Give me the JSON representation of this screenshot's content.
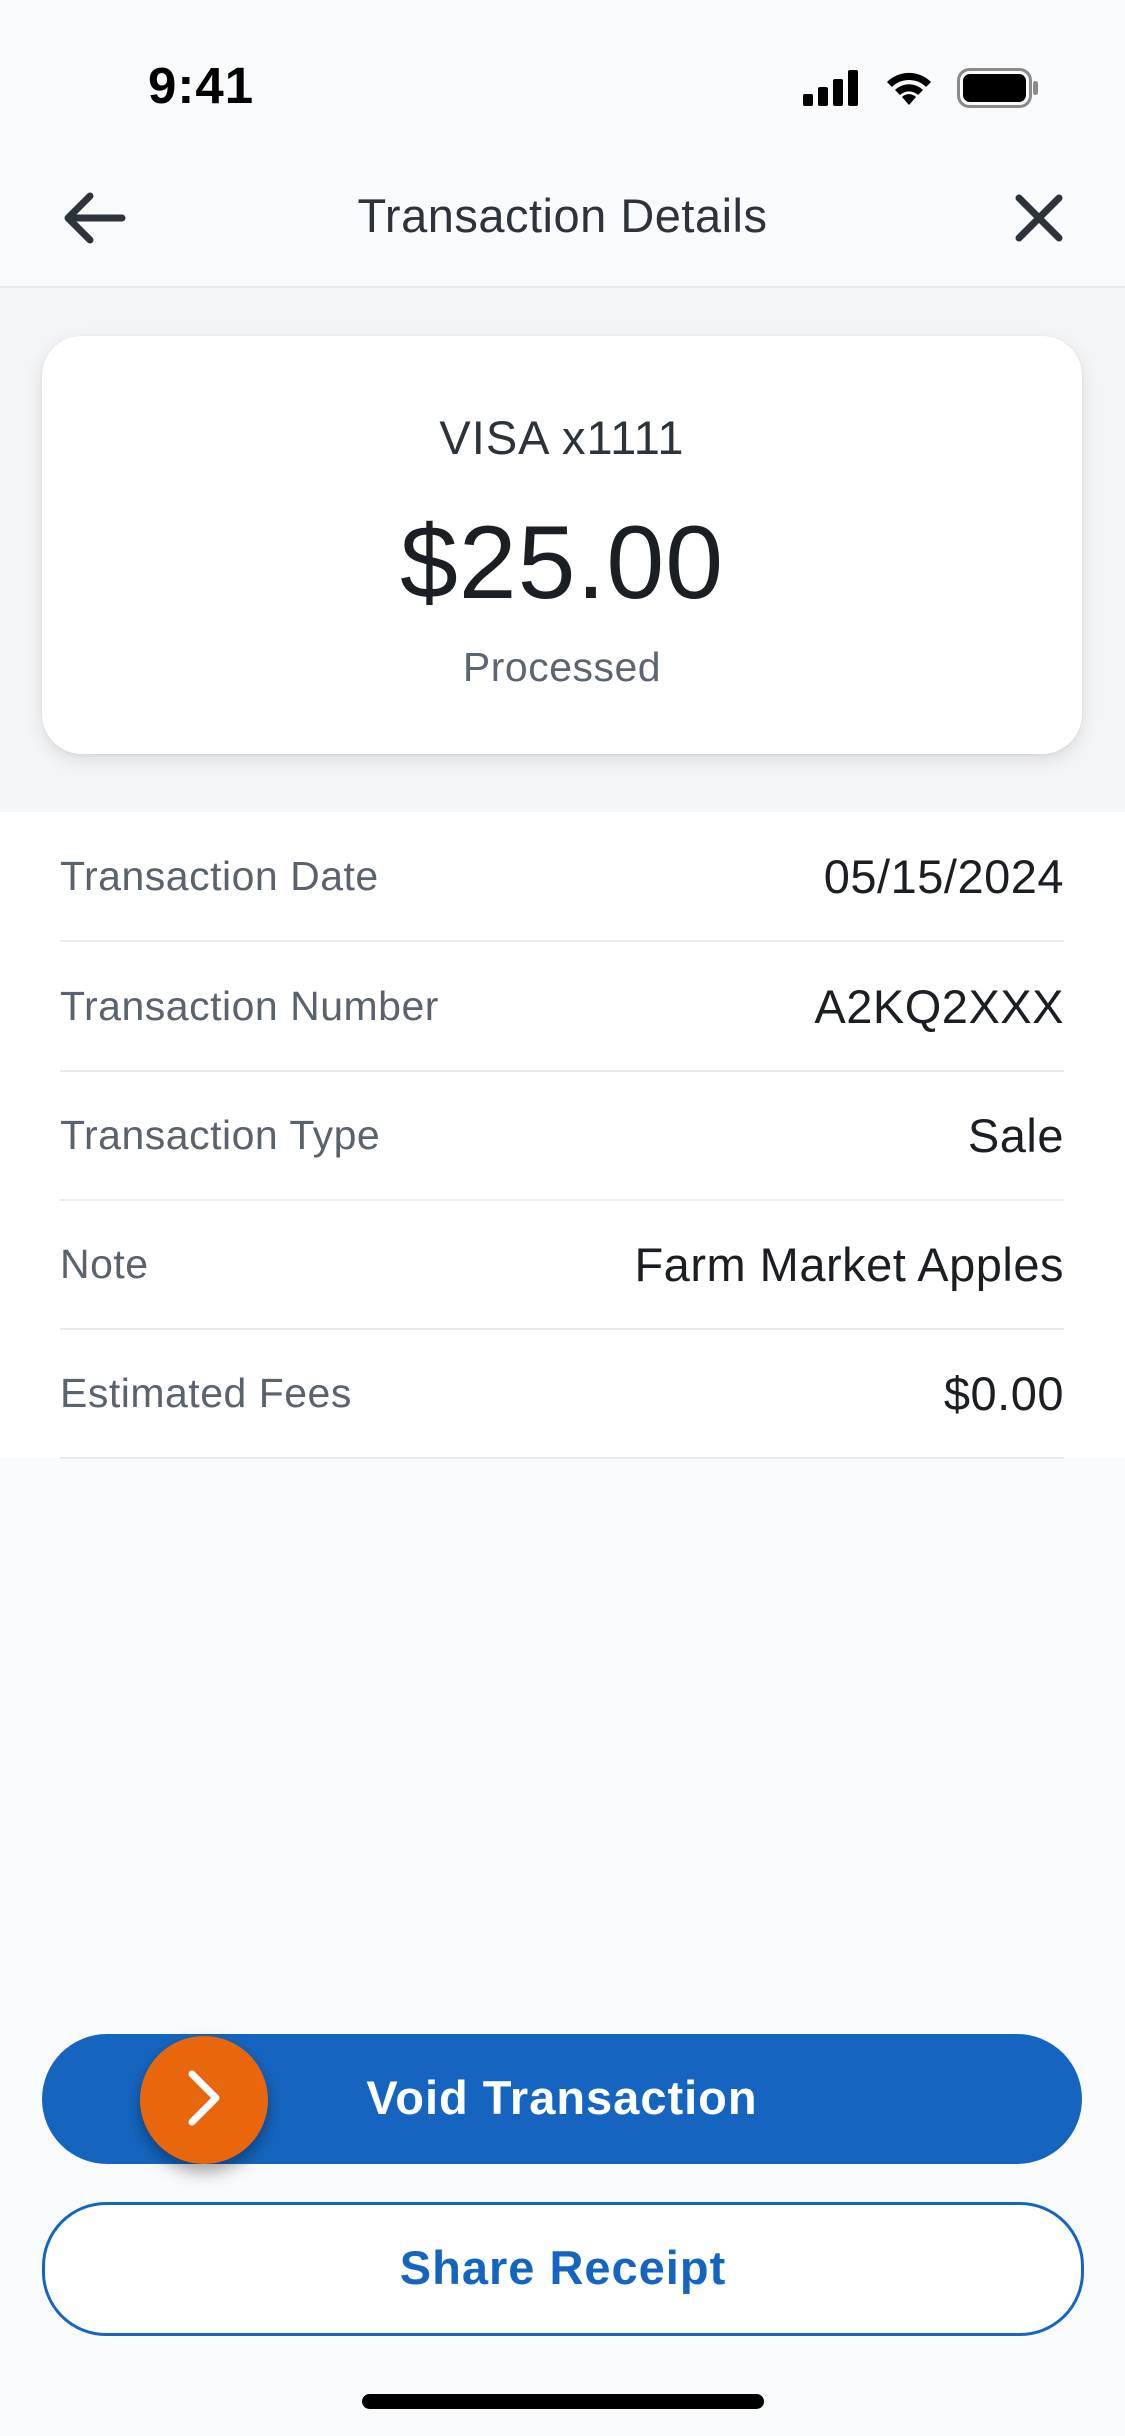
{
  "status_bar": {
    "time": "9:41",
    "icons": [
      "signal-icon",
      "wifi-icon",
      "battery-icon"
    ]
  },
  "header": {
    "title": "Transaction Details",
    "back_icon": "arrow-left-icon",
    "close_icon": "close-icon"
  },
  "summary": {
    "card_label": "VISA x1111",
    "amount": "$25.00",
    "status": "Processed"
  },
  "details": [
    {
      "label": "Transaction Date",
      "value": "05/15/2024"
    },
    {
      "label": "Transaction Number",
      "value": "A2KQ2XXX"
    },
    {
      "label": "Transaction Type",
      "value": "Sale"
    },
    {
      "label": "Note",
      "value": "Farm Market Apples"
    },
    {
      "label": "Estimated Fees",
      "value": "$0.00"
    }
  ],
  "actions": {
    "void_label": "Void Transaction",
    "slide_icon": "chevron-right-icon",
    "share_label": "Share Receipt"
  },
  "colors": {
    "primary": "#1565C0",
    "accent": "#E8660C",
    "background": "#F9FAFB"
  }
}
